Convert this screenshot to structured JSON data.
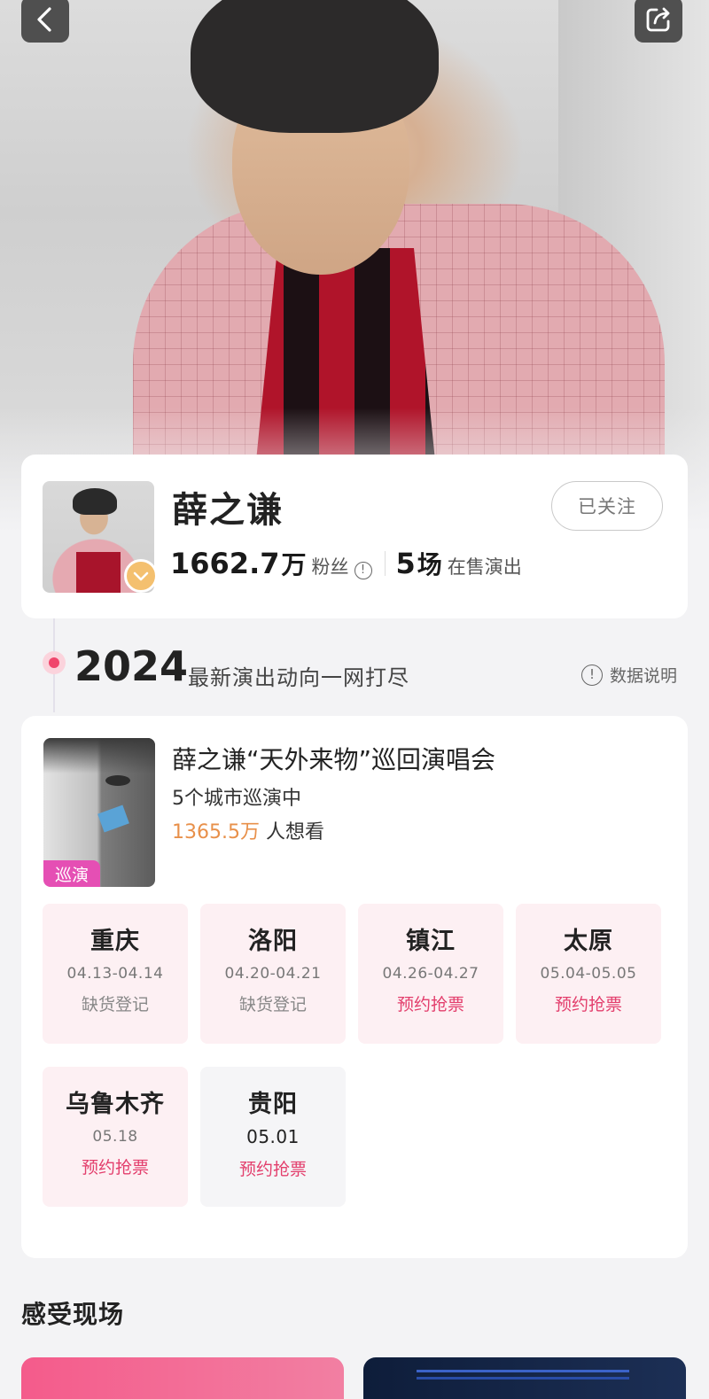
{
  "header": {
    "back_icon": "chevron-left-icon",
    "share_icon": "share-icon"
  },
  "artist": {
    "name": "薛之谦",
    "follow_label": "已关注",
    "fans_value": "1662.7",
    "fans_unit": "万",
    "fans_label": "粉丝",
    "shows_value": "5",
    "shows_unit": "场",
    "shows_label": "在售演出",
    "verified_icon": "check-badge-icon"
  },
  "timeline": {
    "year": "2024",
    "subtitle": "最新演出动向一网打尽",
    "data_note": "数据说明"
  },
  "tour": {
    "tag": "巡演",
    "title": "薛之谦“天外来物”巡回演唱会",
    "cities_text": "5个城市巡演中",
    "want_count": "1365.5万",
    "want_label": "人想看",
    "cities": [
      {
        "name": "重庆",
        "date": "04.13-04.14",
        "status": "缺货登记"
      },
      {
        "name": "洛阳",
        "date": "04.20-04.21",
        "status": "缺货登记"
      },
      {
        "name": "镇江",
        "date": "04.26-04.27",
        "status": "预约抢票"
      },
      {
        "name": "太原",
        "date": "05.04-05.05",
        "status": "预约抢票"
      },
      {
        "name": "乌鲁木齐",
        "date": "05.18",
        "status": "预约抢票"
      },
      {
        "name": "贵阳",
        "date": "05.01",
        "status": "预约抢票"
      }
    ]
  },
  "live": {
    "section_title": "感受现场"
  },
  "colors": {
    "accent_pink": "#e33e6c",
    "tag_pink": "#e54fb4",
    "want_orange": "#e8904a",
    "badge_gold": "#f4c06f"
  }
}
